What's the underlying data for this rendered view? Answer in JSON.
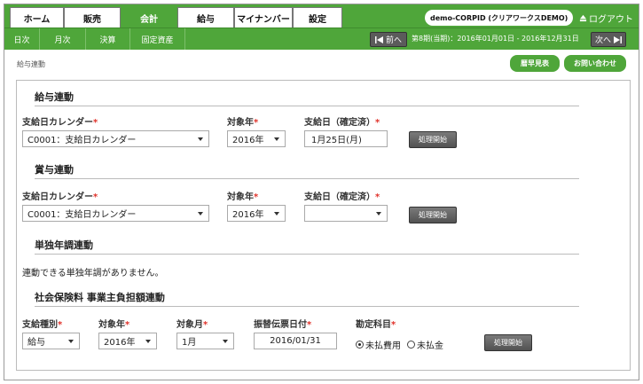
{
  "nav": {
    "tabs": [
      {
        "label": "ホーム"
      },
      {
        "label": "販売"
      },
      {
        "label": "会計"
      },
      {
        "label": "給与"
      },
      {
        "label": "マイナンバー"
      },
      {
        "label": "設定"
      }
    ],
    "corp_label": "demo-CORPID (クリアワークスDEMO)",
    "logout_label": "ログアウト",
    "logout_icon": "eject-icon"
  },
  "subnav": {
    "tabs": [
      {
        "label": "日次"
      },
      {
        "label": "月次"
      },
      {
        "label": "決算"
      },
      {
        "label": "固定資産"
      }
    ],
    "prev_label": "前へ",
    "next_label": "次へ",
    "period_text": "第8期(当期)：2016年01月01日 - 2016年12月31日"
  },
  "breadcrumb": "給与連動",
  "header_buttons": {
    "calendar": "暦早見表",
    "contact": "お問い合わせ"
  },
  "required_mark": "*",
  "salary": {
    "title": "給与連動",
    "calendar_label": "支給日カレンダー",
    "calendar_value": "C0001：支給日カレンダー",
    "year_label": "対象年",
    "year_value": "2016年",
    "date_label": "支給日（確定済）",
    "date_value": "1月25日(月)",
    "button": "処理開始"
  },
  "bonus": {
    "title": "賞与連動",
    "calendar_label": "支給日カレンダー",
    "calendar_value": "C0001：支給日カレンダー",
    "year_label": "対象年",
    "year_value": "2016年",
    "date_label": "支給日（確定済）",
    "date_value": "",
    "button": "処理開始"
  },
  "yearend": {
    "title": "単独年調連動",
    "message": "連動できる単独年調がありません。"
  },
  "social": {
    "title": "社会保険料 事業主負担額連動",
    "type_label": "支給種別",
    "type_value": "給与",
    "year_label": "対象年",
    "year_value": "2016年",
    "month_label": "対象月",
    "month_value": "1月",
    "transfer_label": "振替伝票日付",
    "transfer_value": "2016/01/31",
    "account_label": "勘定科目",
    "radio_options": [
      "未払費用",
      "未払金"
    ],
    "radio_selected": "未払費用",
    "button": "処理開始"
  }
}
